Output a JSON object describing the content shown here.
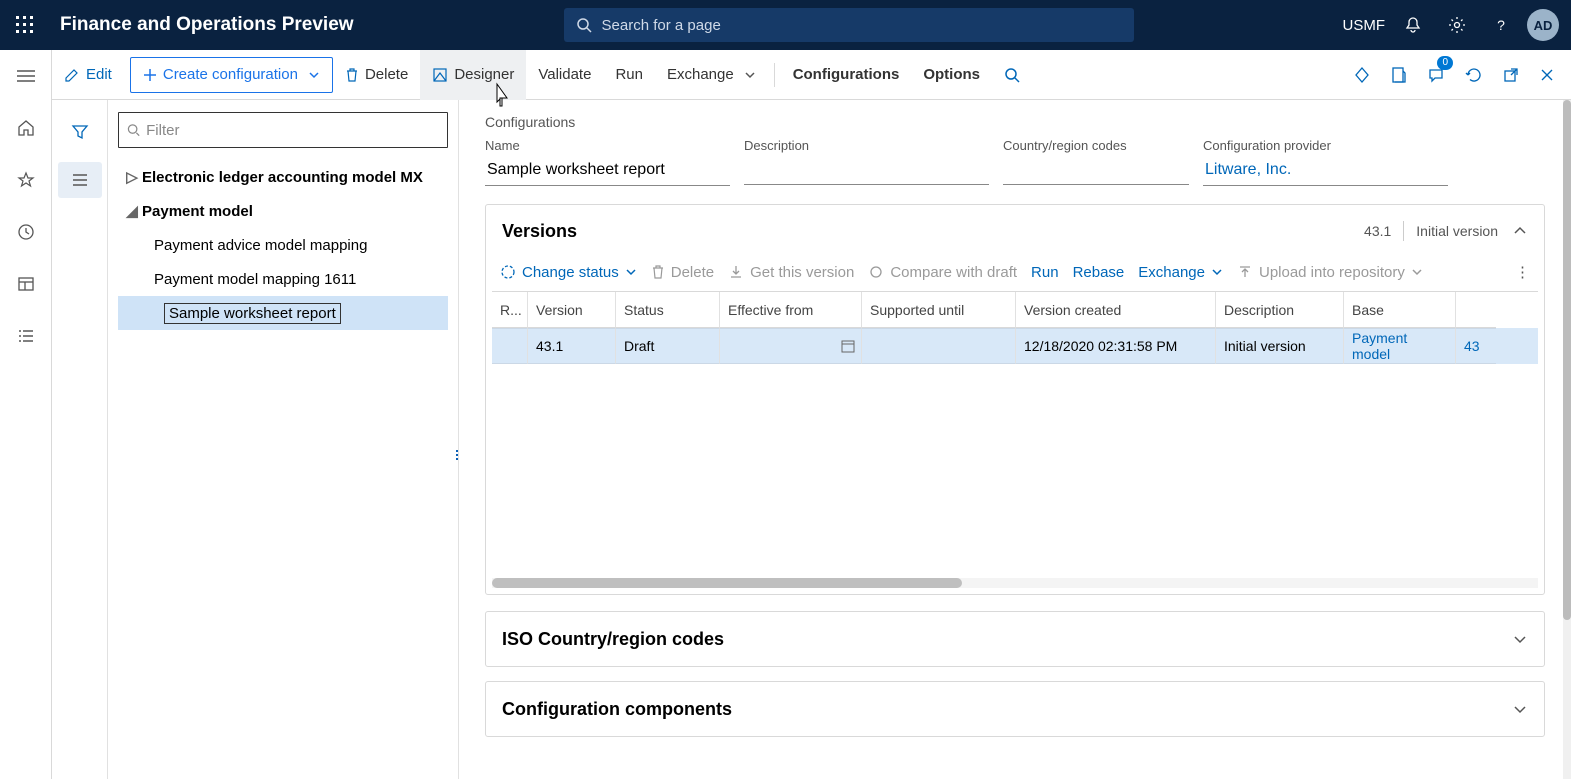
{
  "topbar": {
    "title": "Finance and Operations Preview",
    "search_placeholder": "Search for a page",
    "company": "USMF",
    "avatar": "AD"
  },
  "actionbar": {
    "edit": "Edit",
    "create": "Create configuration",
    "delete": "Delete",
    "designer": "Designer",
    "validate": "Validate",
    "run": "Run",
    "exchange": "Exchange",
    "configurations": "Configurations",
    "options": "Options",
    "badge": "0"
  },
  "tree": {
    "filter_placeholder": "Filter",
    "items": [
      {
        "label": "Electronic ledger accounting model MX",
        "level": 1,
        "expanded": false,
        "bold": true
      },
      {
        "label": "Payment model",
        "level": 1,
        "expanded": true,
        "bold": true
      },
      {
        "label": "Payment advice model mapping",
        "level": 2
      },
      {
        "label": "Payment model mapping 1611",
        "level": 2
      },
      {
        "label": "Sample worksheet report",
        "level": 3,
        "selected": true
      }
    ]
  },
  "main": {
    "crumb": "Configurations",
    "fields": {
      "name_label": "Name",
      "name_value": "Sample worksheet report",
      "desc_label": "Description",
      "desc_value": "",
      "crc_label": "Country/region codes",
      "crc_value": "",
      "provider_label": "Configuration provider",
      "provider_value": "Litware, Inc."
    },
    "versions": {
      "title": "Versions",
      "meta_version": "43.1",
      "meta_desc": "Initial version",
      "toolbar": {
        "change_status": "Change status",
        "delete": "Delete",
        "get": "Get this version",
        "compare": "Compare with draft",
        "run": "Run",
        "rebase": "Rebase",
        "exchange": "Exchange",
        "upload": "Upload into repository"
      },
      "cols": {
        "r": "R...",
        "version": "Version",
        "status": "Status",
        "eff": "Effective from",
        "sup": "Supported until",
        "created": "Version created",
        "desc": "Description",
        "base": "Base",
        "bv": ""
      },
      "rows": [
        {
          "r": "",
          "version": "43.1",
          "status": "Draft",
          "eff": "",
          "sup": "",
          "created": "12/18/2020 02:31:58 PM",
          "desc": "Initial version",
          "base": "Payment model",
          "bv": "43"
        }
      ]
    },
    "iso_title": "ISO Country/region codes",
    "comp_title": "Configuration components"
  }
}
